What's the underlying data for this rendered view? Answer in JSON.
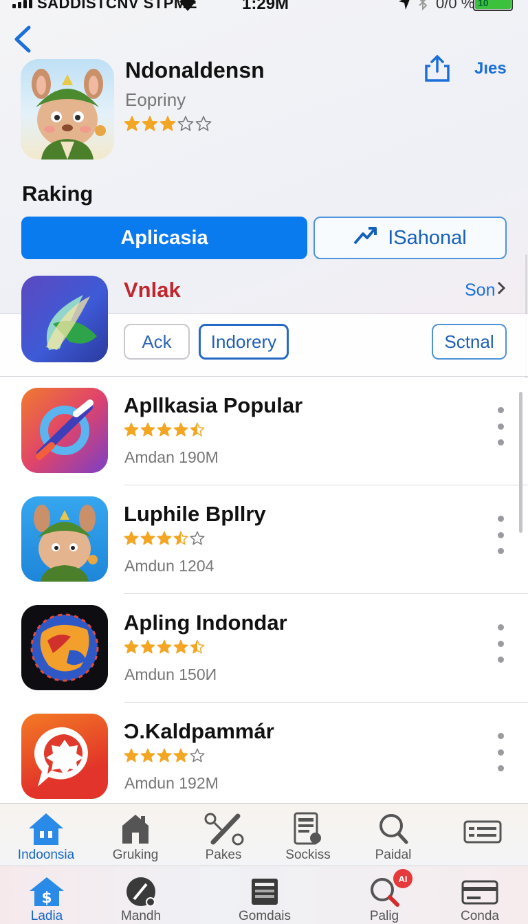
{
  "status_bar": {
    "carrier": "SADDISTCNV STPME",
    "time": "1:29M",
    "battery_text": "0/0 %",
    "battery_level": "10",
    "battery_color": "#3cc13c"
  },
  "header": {
    "title": "Ndonaldensn",
    "subtitle": "Eopriny",
    "rating": 3,
    "rating_max": 5,
    "link": "Jıes",
    "icon": "cartoon-character-app-icon"
  },
  "section_title": "Raking",
  "segments": {
    "primary": "Aplicasia",
    "secondary": "ISahonal"
  },
  "featured": {
    "title": "Vnlak",
    "link": "Son",
    "chips": [
      "Ack",
      "Indorery",
      "Sctnal"
    ]
  },
  "apps": [
    {
      "name": "Apllkasia Popular",
      "rating": 4.5,
      "meta": "Amdan  190M",
      "icon": "abstract-link-app-icon"
    },
    {
      "name": "Luphile Bpllry",
      "rating": 3.5,
      "meta": "Amdun  1204",
      "icon": "cartoon-character-app-icon"
    },
    {
      "name": "Apling Indondar",
      "rating": 4.5,
      "meta": "Amdun  150И",
      "icon": "globe-app-icon"
    },
    {
      "name": "Ɔ.Kaldpammár",
      "rating": 4,
      "meta": "Amdun  192M",
      "icon": "chat-gear-app-icon"
    }
  ],
  "tabs_top": [
    {
      "label": "Indoonsia",
      "icon": "home-icon",
      "active": true
    },
    {
      "label": "Gruking",
      "icon": "house-outline-icon"
    },
    {
      "label": "Pakes",
      "icon": "tools-icon"
    },
    {
      "label": "Sockiss",
      "icon": "document-icon"
    },
    {
      "label": "Paidal",
      "icon": "search-icon"
    },
    {
      "label": "",
      "icon": "list-card-icon"
    }
  ],
  "tabs_bottom": [
    {
      "label": "Ladia",
      "icon": "home-dollar-icon",
      "active": true
    },
    {
      "label": "Mandh",
      "icon": "compass-icon"
    },
    {
      "label": "Gomdais",
      "icon": "grid-card-icon"
    },
    {
      "label": "Palig",
      "icon": "search-icon",
      "badge": "AI"
    },
    {
      "label": "Conda",
      "icon": "card-icon"
    }
  ],
  "colors": {
    "accent": "#0a7aef",
    "link": "#1a6fd8",
    "featured_title": "#c0272d",
    "star": "#f2a623"
  }
}
